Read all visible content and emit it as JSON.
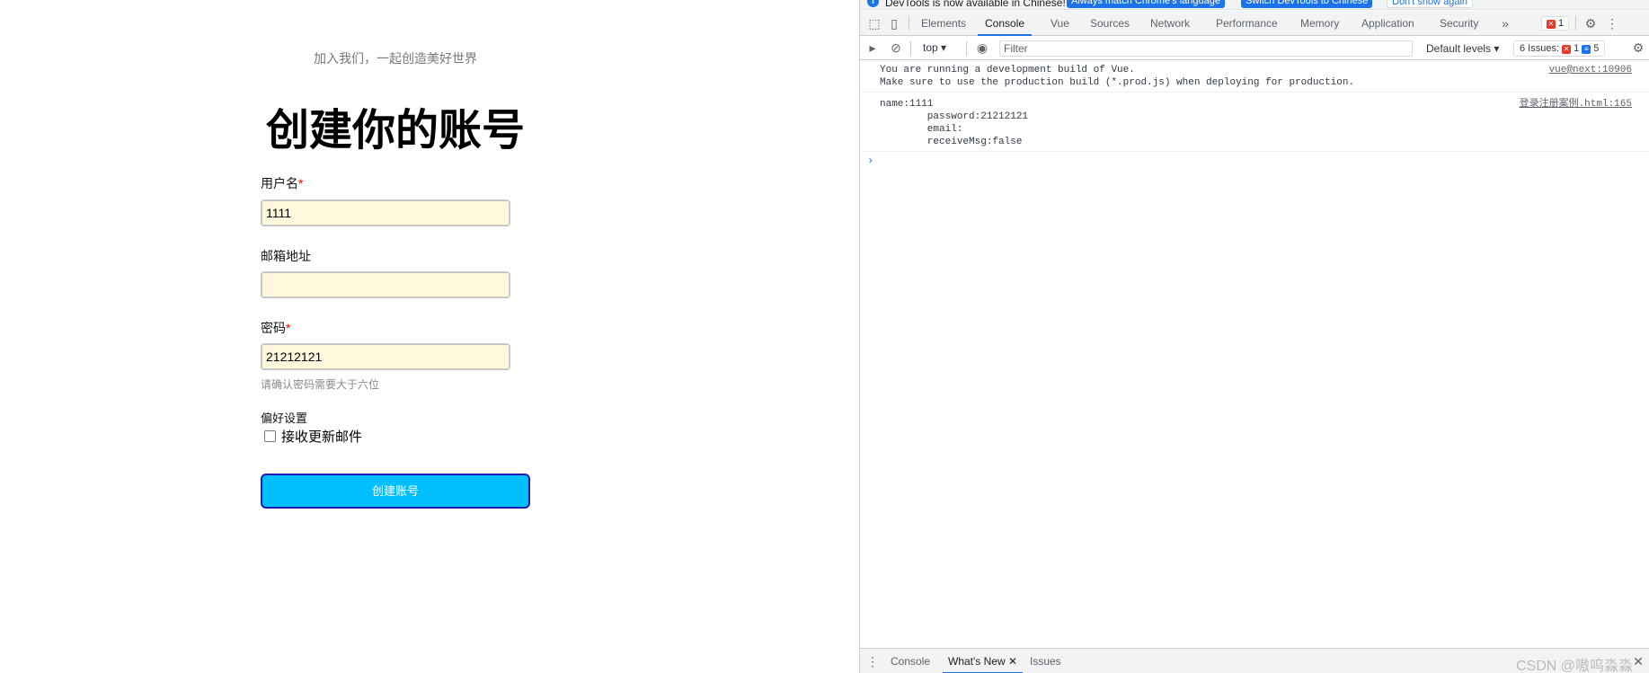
{
  "form": {
    "subtitle": "加入我们，一起创造美好世界",
    "title": "创建你的账号",
    "username_label": "用户名",
    "username_required": "*",
    "username_value": "1111",
    "email_label": "邮箱地址",
    "email_value": "",
    "password_label": "密码",
    "password_required": "*",
    "password_value": "21212121",
    "password_hint": "请确认密码需要大于六位",
    "preferences_label": "偏好设置",
    "receive_label": "接收更新邮件",
    "submit_label": "创建账号"
  },
  "devtools": {
    "infobar": {
      "text": "DevTools is now available in Chinese!",
      "btn_match": "Always match Chrome's language",
      "btn_switch": "Switch DevTools to Chinese",
      "btn_dont": "Don't show again"
    },
    "tabs": [
      "Elements",
      "Console",
      "Vue",
      "Sources",
      "Network",
      "Performance",
      "Memory",
      "Application",
      "Security"
    ],
    "active_tab": "Console",
    "error_count": "1",
    "context": "top",
    "filter_placeholder": "Filter",
    "levels": "Default levels",
    "issues_label": "6 Issues:",
    "issues_errors": "1",
    "issues_info": "5",
    "messages": [
      {
        "lines": [
          "You are running a development build of Vue.",
          "Make sure to use the production build (*.prod.js) when deploying for production."
        ],
        "source": "vue@next:10906"
      },
      {
        "lines": [
          "name:1111",
          "        password:21212121",
          "        email:",
          "        receiveMsg:false"
        ],
        "source": "登录注册案例.html:165"
      }
    ],
    "drawer_tabs": [
      "Console",
      "What's New",
      "Issues"
    ],
    "drawer_active": "What's New",
    "watermark": "CSDN @嗷呜淼淼"
  }
}
